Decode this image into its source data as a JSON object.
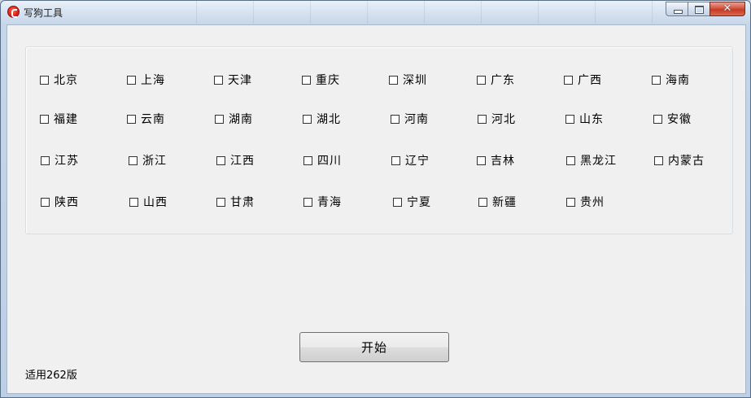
{
  "window": {
    "title": "写狗工具",
    "close_glyph": "✕"
  },
  "checkboxes": [
    {
      "label": "北京",
      "checked": false
    },
    {
      "label": "上海",
      "checked": false
    },
    {
      "label": "天津",
      "checked": false
    },
    {
      "label": "重庆",
      "checked": false
    },
    {
      "label": "深圳",
      "checked": false
    },
    {
      "label": "广东",
      "checked": false
    },
    {
      "label": "广西",
      "checked": false
    },
    {
      "label": "海南",
      "checked": false
    },
    {
      "label": "福建",
      "checked": false
    },
    {
      "label": "云南",
      "checked": false
    },
    {
      "label": "湖南",
      "checked": false
    },
    {
      "label": "湖北",
      "checked": false
    },
    {
      "label": "河南",
      "checked": false
    },
    {
      "label": "河北",
      "checked": false
    },
    {
      "label": "山东",
      "checked": false
    },
    {
      "label": "安徽",
      "checked": false
    },
    {
      "label": "江苏",
      "checked": false
    },
    {
      "label": "浙江",
      "checked": false
    },
    {
      "label": "江西",
      "checked": false
    },
    {
      "label": "四川",
      "checked": false
    },
    {
      "label": "辽宁",
      "checked": false
    },
    {
      "label": "吉林",
      "checked": false
    },
    {
      "label": "黑龙江",
      "checked": false
    },
    {
      "label": "内蒙古",
      "checked": false
    },
    {
      "label": "陕西",
      "checked": false
    },
    {
      "label": "山西",
      "checked": false
    },
    {
      "label": "甘肃",
      "checked": false
    },
    {
      "label": "青海",
      "checked": false
    },
    {
      "label": "宁夏",
      "checked": false
    },
    {
      "label": "新疆",
      "checked": false
    },
    {
      "label": "贵州",
      "checked": false
    }
  ],
  "start_button": {
    "label": "开始"
  },
  "status": {
    "text": "适用262版"
  }
}
